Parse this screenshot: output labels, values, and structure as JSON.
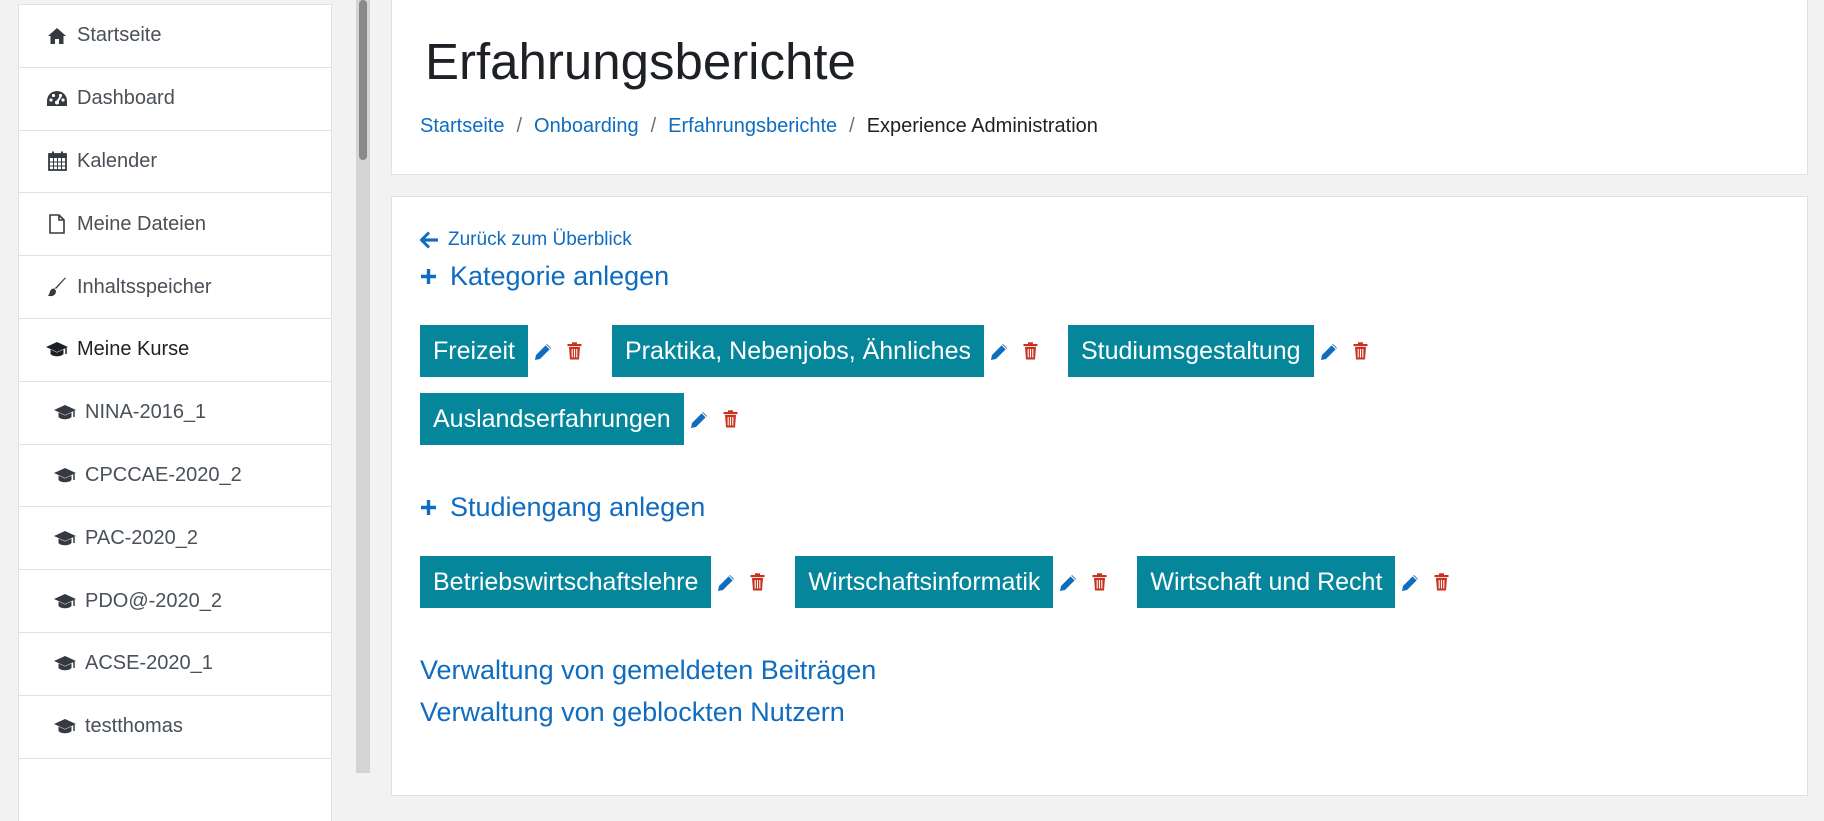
{
  "sidebar": {
    "items": [
      {
        "label": "Startseite",
        "icon": "home-icon"
      },
      {
        "label": "Dashboard",
        "icon": "dashboard-icon"
      },
      {
        "label": "Kalender",
        "icon": "calendar-icon"
      },
      {
        "label": "Meine Dateien",
        "icon": "file-icon"
      },
      {
        "label": "Inhaltsspeicher",
        "icon": "brush-icon"
      },
      {
        "label": "Meine Kurse",
        "icon": "graduation-cap-icon"
      }
    ],
    "courses": [
      {
        "label": "NINA-2016_1"
      },
      {
        "label": "CPCCAE-2020_2"
      },
      {
        "label": "PAC-2020_2"
      },
      {
        "label": "PDO@-2020_2"
      },
      {
        "label": "ACSE-2020_1"
      },
      {
        "label": "testthomas"
      }
    ]
  },
  "header": {
    "title": "Erfahrungsberichte",
    "breadcrumb": [
      {
        "label": "Startseite"
      },
      {
        "label": "Onboarding"
      },
      {
        "label": "Erfahrungsberichte"
      },
      {
        "label": "Experience Administration"
      }
    ],
    "separator": "/"
  },
  "main": {
    "back_link": "Zurück zum Überblick",
    "add_category": "Kategorie anlegen",
    "categories": [
      "Freizeit",
      "Praktika, Nebenjobs, Ähnliches",
      "Studiumsgestaltung",
      "Auslandserfahrungen"
    ],
    "add_studiengang": "Studiengang anlegen",
    "studiengaenge": [
      "Betriebswirtschaftslehre",
      "Wirtschaftsinformatik",
      "Wirtschaft und Recht"
    ],
    "admin_reported": "Verwaltung von gemeldeten Beiträgen",
    "admin_blocked": "Verwaltung von geblockten Nutzern"
  },
  "colors": {
    "link": "#0f6cbf",
    "chip": "#06869a",
    "delete": "#ca3120",
    "text": "#1d2125"
  }
}
